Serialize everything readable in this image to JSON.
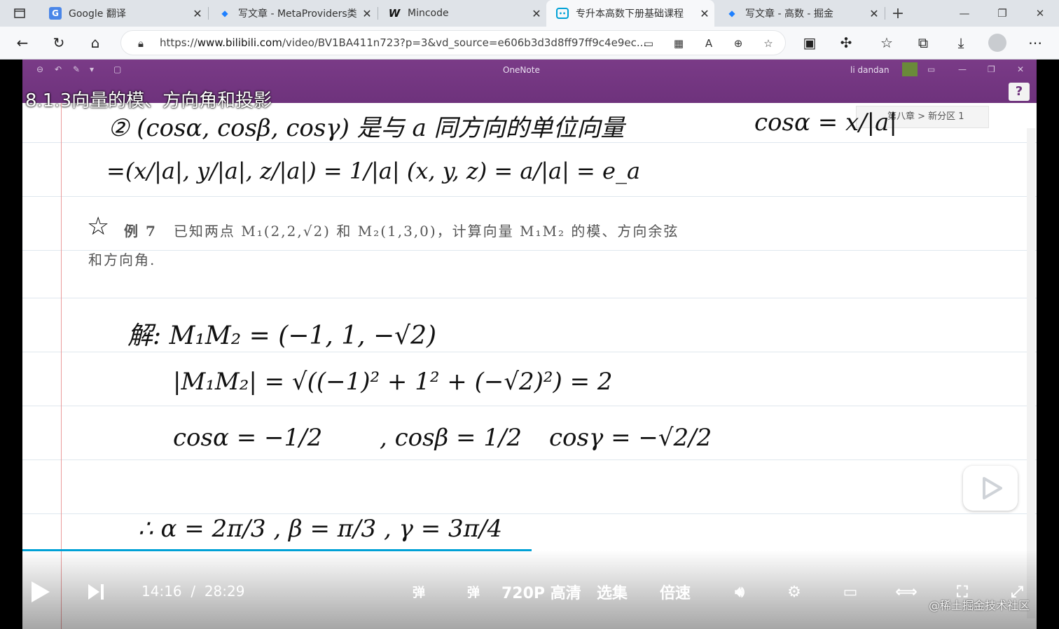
{
  "browser": {
    "tabs": [
      {
        "label": "Google 翻译",
        "icon": "google-translate-icon"
      },
      {
        "label": "写文章 - MetaProviders类",
        "icon": "juejin-icon"
      },
      {
        "label": "Mincode",
        "icon": "w-icon"
      },
      {
        "label": "专升本高数下册基础课程",
        "icon": "bilibili-icon",
        "active": true
      },
      {
        "label": "写文章 - 高数 - 掘金",
        "icon": "juejin-icon"
      }
    ],
    "url_prefix": "https://",
    "url_host": "www.bilibili.com",
    "url_path": "/video/BV1BA411n723?p=3&vd_source=e606b3d3d8ff97ff9c4e9ec..."
  },
  "onenote": {
    "app_title": "OneNote",
    "user": "li dandan",
    "section_path": "第八章 > 新分区 1"
  },
  "video": {
    "title": "8.1.3向量的模、方向角和投影",
    "current_time": "14:16",
    "separator": "/",
    "duration": "28:29",
    "progress": 0.502,
    "quality_label": "720P 高清",
    "episodes_label": "选集",
    "speed_label": "倍速",
    "watermark": "@稀土掘金技术社区"
  },
  "note": {
    "line1": "② (cosα, cosβ, cosγ) 是与 a 同方向的单位向量",
    "line2": "=(x/|a|, y/|a|, z/|a|) = 1/|a| (x, y, z) = a/|a| = e_a",
    "right_top": "cosα = x/|a|",
    "example_label": "例 7",
    "example_text": "已知两点 M₁(2,2,√2) 和 M₂(1,3,0)，计算向量 M₁M₂ 的模、方向余弦",
    "example_text2": "和方向角.",
    "sol1": "解: M₁M₂ = (−1, 1, −√2)",
    "sol2": "|M₁M₂| = √((−1)² + 1² + (−√2)²) = 2",
    "sol3a": "cosα = −1/2",
    "sol3b": ", cosβ = 1/2",
    "sol3c": "cosγ = −√2/2",
    "sol4": "∴ α = 2π/3 ,  β = π/3 ,  γ = 3π/4"
  }
}
